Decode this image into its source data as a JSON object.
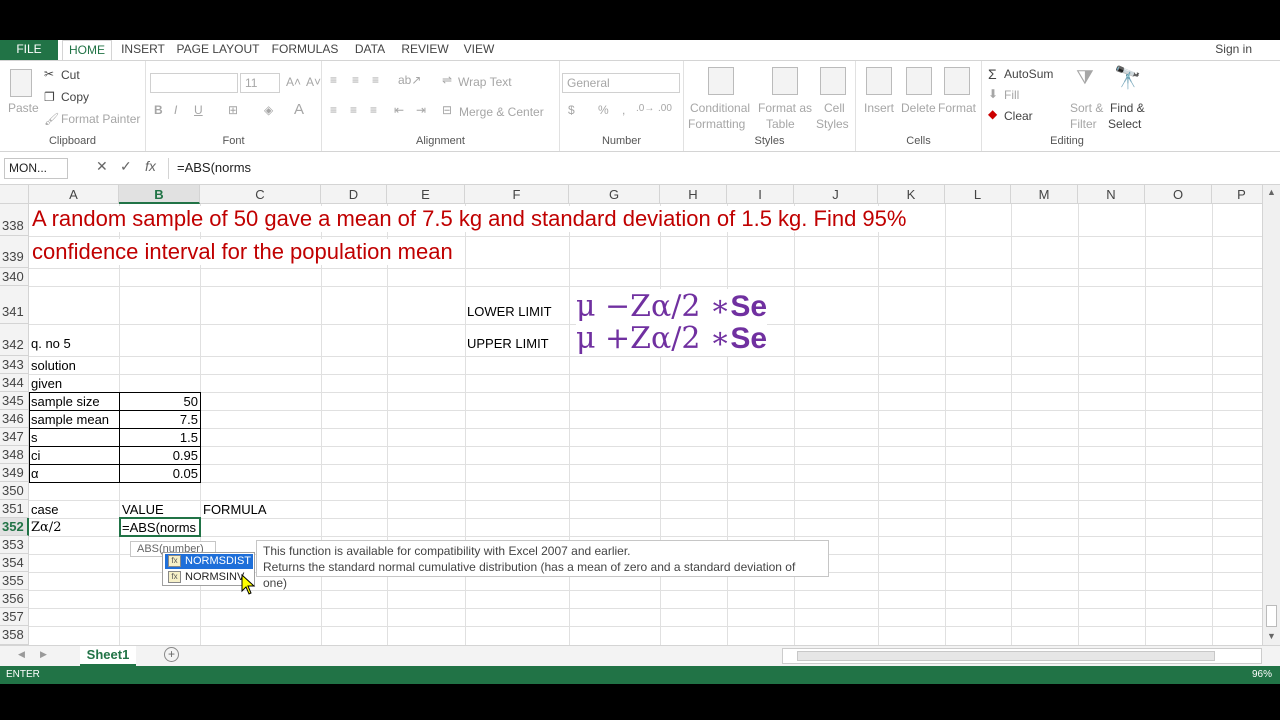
{
  "ribbon_tabs": [
    "FILE",
    "HOME",
    "INSERT",
    "PAGE LAYOUT",
    "FORMULAS",
    "DATA",
    "REVIEW",
    "VIEW"
  ],
  "signin": "Sign in",
  "clipboard": {
    "paste": "Paste",
    "cut": "Cut",
    "copy": "Copy",
    "format_painter": "Format Painter",
    "label": "Clipboard"
  },
  "font": {
    "size": "11",
    "label": "Font"
  },
  "alignment": {
    "wrap": "Wrap Text",
    "merge": "Merge & Center",
    "label": "Alignment"
  },
  "number": {
    "format": "General",
    "label": "Number"
  },
  "styles": {
    "conditional": [
      "Conditional",
      "Formatting"
    ],
    "format_table": [
      "Format as",
      "Table"
    ],
    "cell_styles": [
      "Cell",
      "Styles"
    ],
    "label": "Styles"
  },
  "cells": {
    "insert": "Insert",
    "delete": "Delete",
    "format": "Format",
    "label": "Cells"
  },
  "editing": {
    "autosum": "AutoSum",
    "fill": "Fill",
    "clear": "Clear",
    "sort": [
      "Sort &",
      "Filter"
    ],
    "find": [
      "Find &",
      "Select"
    ],
    "label": "Editing"
  },
  "formula_bar": {
    "name_box": "MON...",
    "fx": "fx",
    "value": "=ABS(norms"
  },
  "columns": [
    "A",
    "B",
    "C",
    "D",
    "E",
    "F",
    "G",
    "H",
    "I",
    "J",
    "K",
    "L",
    "M",
    "N",
    "O",
    "P"
  ],
  "rows": [
    "338",
    "339",
    "340",
    "341",
    "342",
    "343",
    "344",
    "345",
    "346",
    "347",
    "348",
    "349",
    "350",
    "351",
    "352",
    "353",
    "354",
    "355",
    "356",
    "357",
    "358"
  ],
  "sheet": {
    "title_line1": "A random sample of 50 gave a mean of 7.5 kg and standard deviation of 1.5 kg. Find 95%",
    "title_line2": "confidence interval for the population mean",
    "lower_label": "LOWER LIMIT",
    "upper_label": "UPPER LIMIT",
    "lower_formula": "μ −Zα/2 ∗",
    "upper_formula": "μ +Zα/2 ∗",
    "se": "Se",
    "q_no": "q. no 5",
    "solution": "solution",
    "given": "given",
    "params": [
      {
        "name": "sample size",
        "value": "50"
      },
      {
        "name": "sample mean",
        "value": "7.5"
      },
      {
        "name": "s",
        "value": "1.5"
      },
      {
        "name": "ci",
        "value": "0.95"
      },
      {
        "name": "α",
        "value": "0.05"
      }
    ],
    "case_hdr": "case",
    "value_hdr": "VALUE",
    "formula_hdr": "FORMULA",
    "z_label": "Zα/2",
    "z_value": "=ABS(norms"
  },
  "autocomplete": {
    "arg_hint": "ABS(number)",
    "items": [
      "NORMSDIST",
      "NORMSINV"
    ],
    "tooltip_line1": "This function is available for compatibility with Excel 2007 and earlier.",
    "tooltip_line2": "Returns the standard normal cumulative distribution (has a mean of zero and a standard deviation of one)"
  },
  "sheet_tab": "Sheet1",
  "status": "ENTER",
  "zoom": "96%"
}
